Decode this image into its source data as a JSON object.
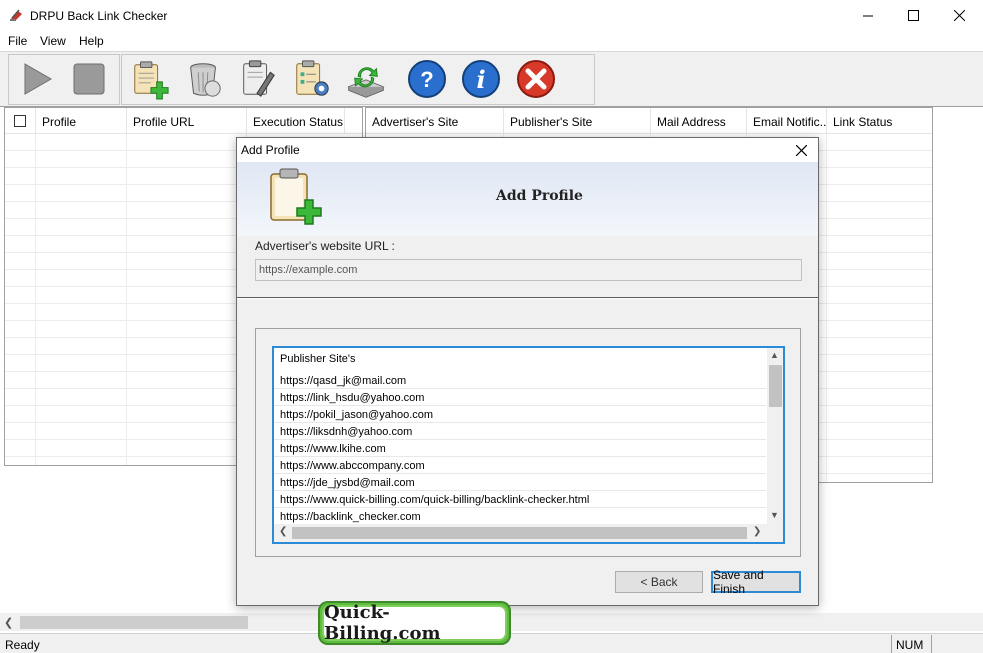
{
  "window": {
    "title": "DRPU Back Link Checker"
  },
  "menu": [
    "File",
    "View",
    "Help"
  ],
  "toolbar": {
    "icons": [
      "play-icon",
      "stop-icon",
      "add-profile-icon",
      "delete-profile-icon",
      "edit-profile-icon",
      "settings-icon",
      "update-icon",
      "help-icon",
      "about-icon",
      "exit-icon"
    ]
  },
  "left_grid": {
    "columns": [
      "Profile",
      "Profile URL",
      "Execution Status"
    ]
  },
  "right_grid": {
    "columns": [
      "Advertiser's Site",
      "Publisher's Site",
      "Mail Address",
      "Email Notific...",
      "Link Status"
    ]
  },
  "dialog": {
    "title": "Add Profile",
    "heading": "Add Profile",
    "url_label": "Advertiser's website URL :",
    "url_placeholder": "https://example.com",
    "list_header": "Publisher Site's",
    "publisher_sites": [
      "https://qasd_jk@mail.com",
      "https://link_hsdu@yahoo.com",
      "https://pokil_jason@yahoo.com",
      "https://liksdnh@yahoo.com",
      "https://www.lkihe.com",
      "https://www.abccompany.com",
      "https://jde_jysbd@mail.com",
      "https://www.quick-billing.com/quick-billing/backlink-checker.html",
      "https://backlink_checker.com"
    ],
    "back_label": "< Back",
    "save_label": "Save and Finish"
  },
  "status": {
    "text": "Ready",
    "num": "NUM"
  },
  "watermark": "Quick-Billing.com",
  "colors": {
    "accent": "#2c8bd4",
    "watermark_green": "#5fbe3f"
  }
}
